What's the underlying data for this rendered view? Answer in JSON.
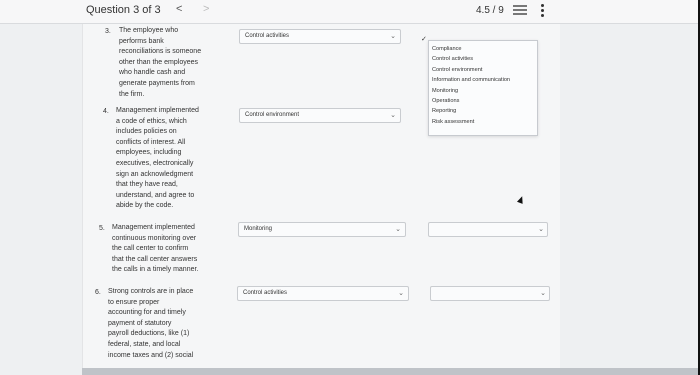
{
  "header": {
    "question_counter": "Question 3 of 3",
    "prev_label": "<",
    "next_label": ">",
    "score": "4.5 / 9"
  },
  "questions": [
    {
      "number": "3.",
      "lines": [
        "The employee who",
        "performs bank",
        "reconciliations is someone",
        "other than the employees",
        "who handle cash and",
        "generate payments from",
        "the firm."
      ],
      "selected": "Control activities"
    },
    {
      "number": "4.",
      "lines": [
        "Management implemented",
        "a code of ethics, which",
        "includes policies on",
        "conflicts of interest. All",
        "employees, including",
        "executives, electronically",
        "sign an acknowledgment",
        "that they have read,",
        "understand, and agree to",
        "abide by the code."
      ],
      "selected": "Control environment"
    },
    {
      "number": "5.",
      "lines": [
        "Management implemented",
        "continuous monitoring over",
        "the call center to confirm",
        "that the call center answers",
        "the calls in a timely manner."
      ],
      "selected": "Monitoring"
    },
    {
      "number": "6.",
      "lines": [
        "Strong controls are in place",
        "to ensure proper",
        "accounting for and timely",
        "payment of statutory",
        "payroll deductions, like (1)",
        "federal, state, and local",
        "income taxes and (2) social"
      ],
      "selected": "Control activities"
    }
  ],
  "dropdown": {
    "checkmark": "✓",
    "options": [
      "Compliance",
      "Control activities",
      "Control environment",
      "Information and communication",
      "Monitoring",
      "Operations",
      "Reporting",
      "Risk assessment"
    ]
  },
  "chevron_glyph": "⌄"
}
